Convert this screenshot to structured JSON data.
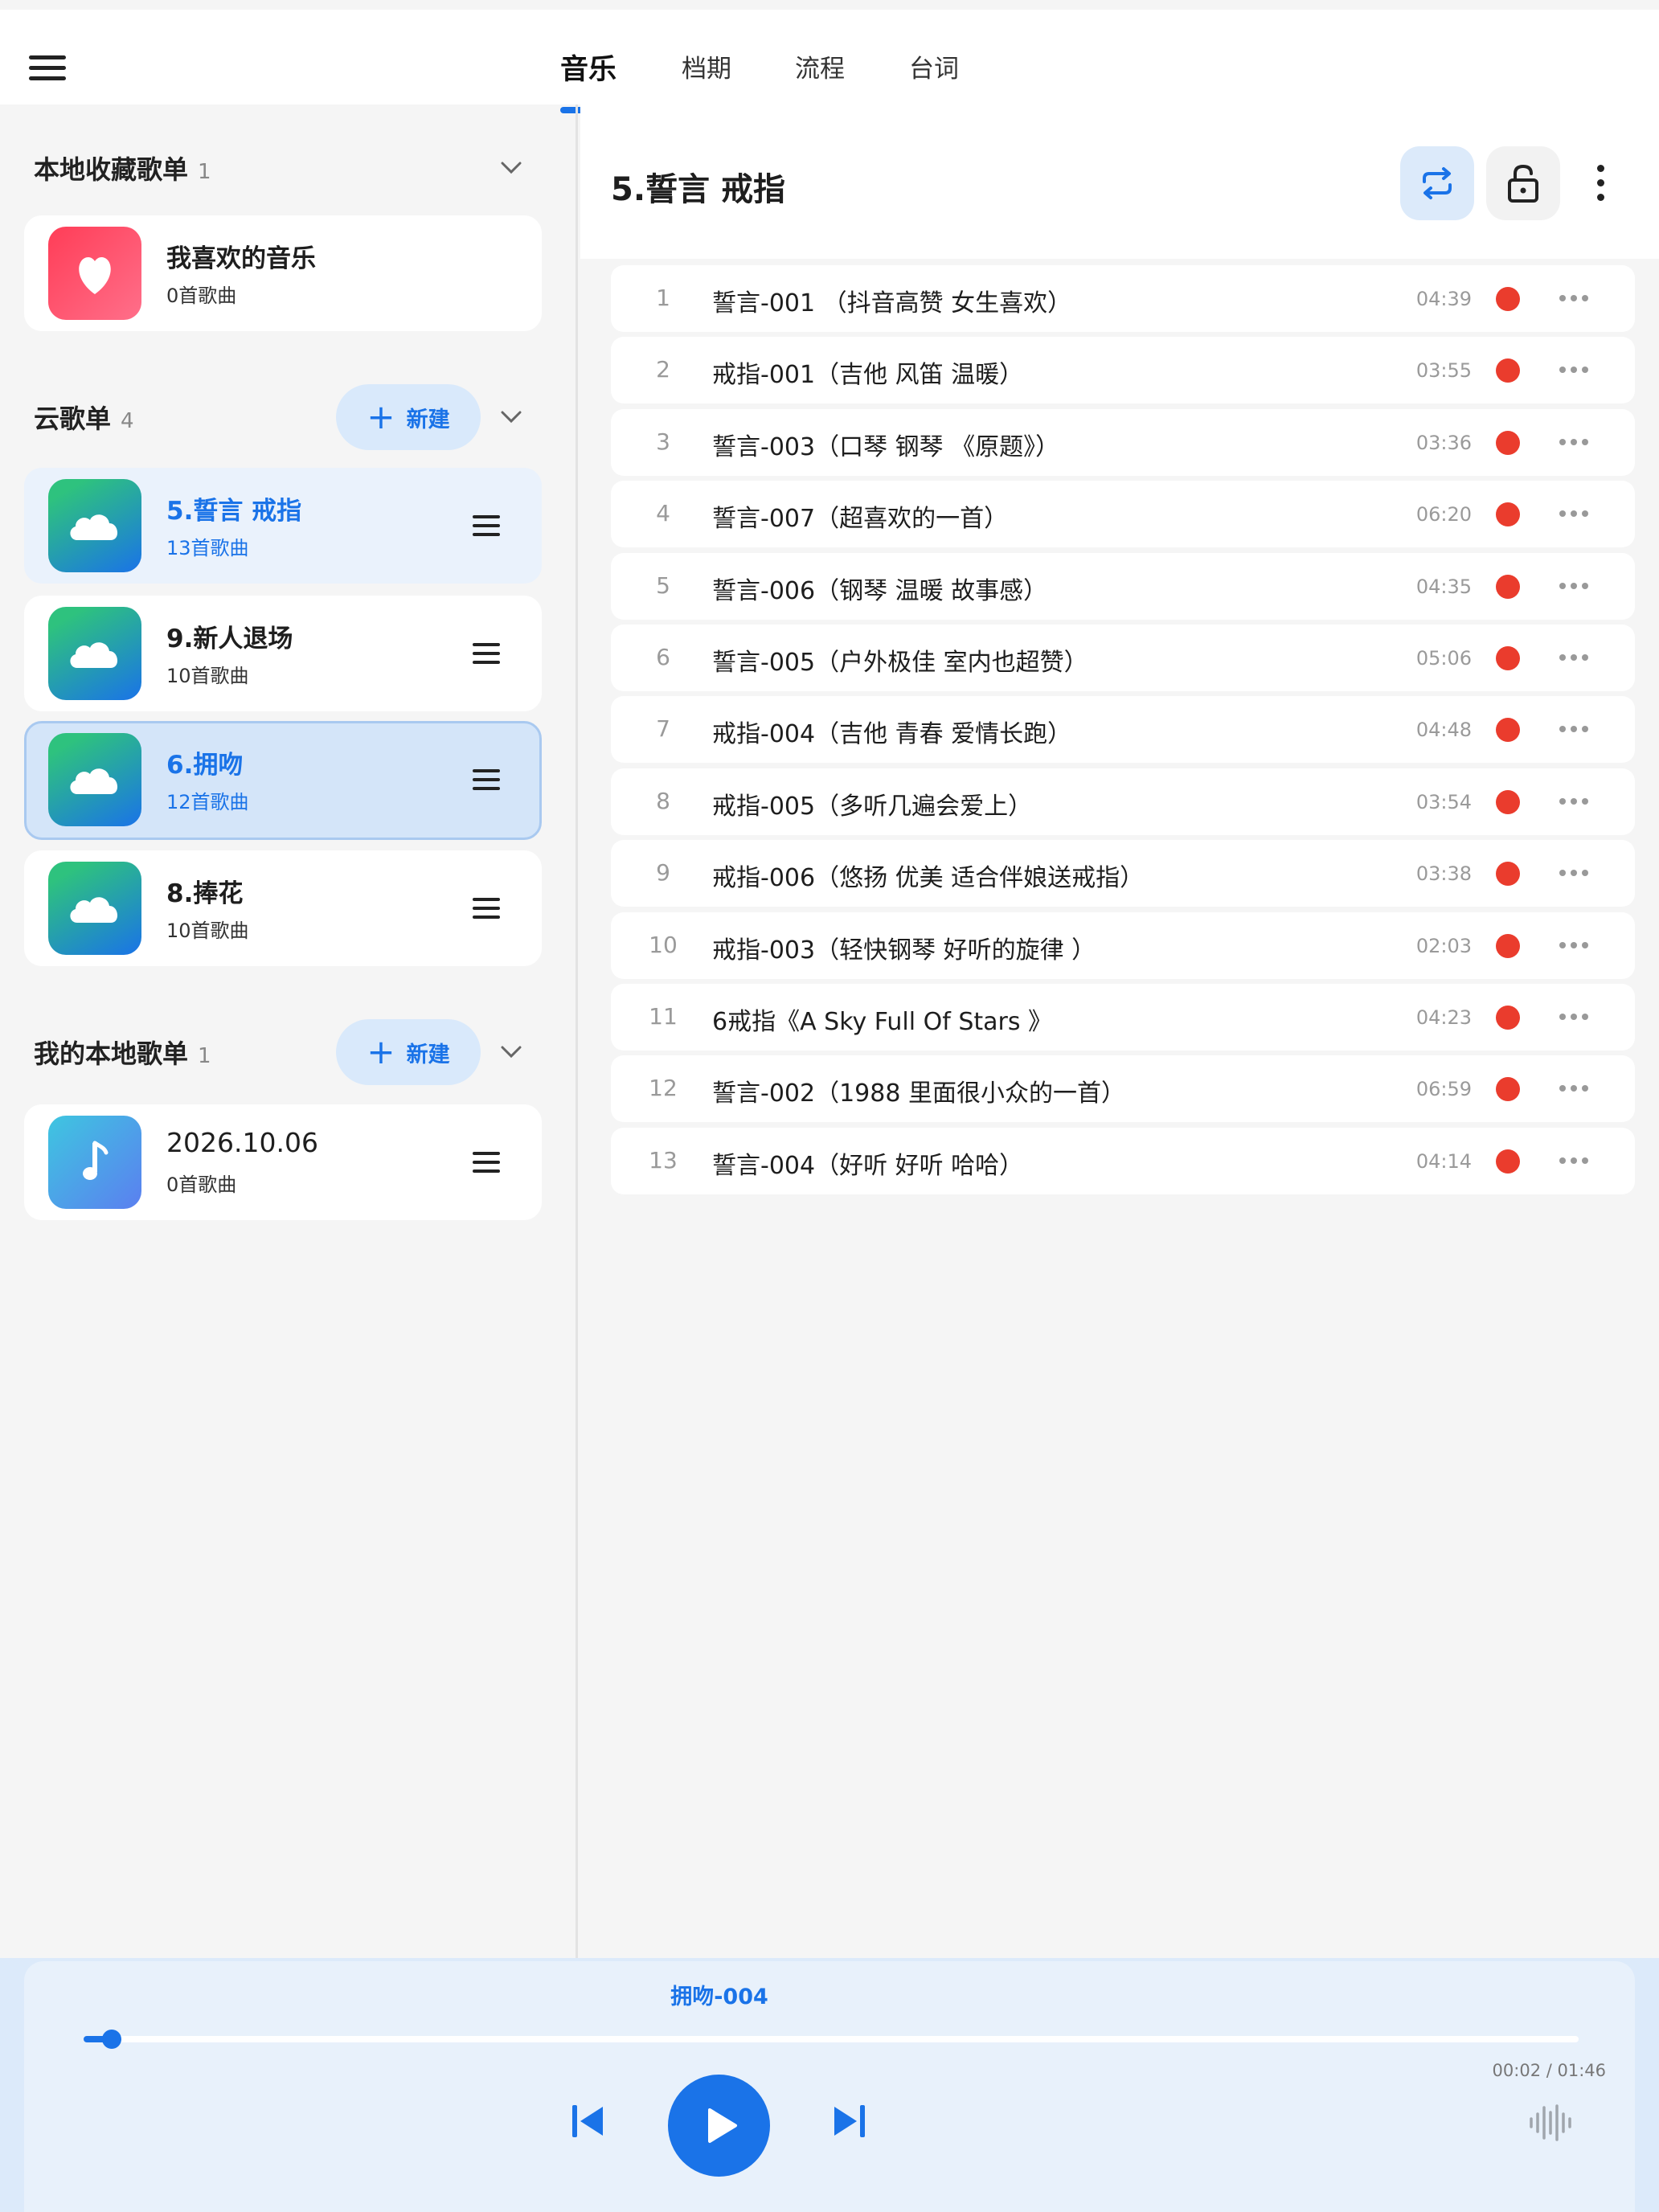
{
  "tabs": [
    {
      "label": "音乐",
      "active": true
    },
    {
      "label": "档期",
      "active": false
    },
    {
      "label": "流程",
      "active": false
    },
    {
      "label": "台词",
      "active": false
    }
  ],
  "sidebar": {
    "favorites": {
      "title": "本地收藏歌单",
      "count": "1",
      "items": [
        {
          "title": "我喜欢的音乐",
          "subtitle": "0首歌曲",
          "icon": "heart-icon"
        }
      ]
    },
    "cloud": {
      "title": "云歌单",
      "count": "4",
      "new_label": "新建",
      "items": [
        {
          "title": "5.誓言 戒指",
          "subtitle": "13首歌曲",
          "icon": "cloud-icon",
          "state": "selected"
        },
        {
          "title": "9.新人退场",
          "subtitle": "10首歌曲",
          "icon": "cloud-icon",
          "state": "normal"
        },
        {
          "title": "6.拥吻",
          "subtitle": "12首歌曲",
          "icon": "cloud-icon",
          "state": "playing"
        },
        {
          "title": "8.捧花",
          "subtitle": "10首歌曲",
          "icon": "cloud-icon",
          "state": "normal"
        }
      ]
    },
    "local": {
      "title": "我的本地歌单",
      "count": "1",
      "new_label": "新建",
      "items": [
        {
          "title": "2026.10.06",
          "subtitle": "0首歌曲",
          "icon": "music-note-icon"
        }
      ]
    }
  },
  "main": {
    "title": "5.誓言 戒指",
    "tracks": [
      {
        "num": "1",
        "name": "誓言-001 （抖音高赞 女生喜欢）",
        "duration": "04:39"
      },
      {
        "num": "2",
        "name": "戒指-001（吉他 风笛 温暖）",
        "duration": "03:55"
      },
      {
        "num": "3",
        "name": "誓言-003（口琴 钢琴 《原题》）",
        "duration": "03:36"
      },
      {
        "num": "4",
        "name": "誓言-007（超喜欢的一首）",
        "duration": "06:20"
      },
      {
        "num": "5",
        "name": "誓言-006（钢琴 温暖 故事感）",
        "duration": "04:35"
      },
      {
        "num": "6",
        "name": "誓言-005（户外极佳 室内也超赞）",
        "duration": "05:06"
      },
      {
        "num": "7",
        "name": "戒指-004（吉他 青春 爱情长跑）",
        "duration": "04:48"
      },
      {
        "num": "8",
        "name": "戒指-005（多听几遍会爱上）",
        "duration": "03:54"
      },
      {
        "num": "9",
        "name": "戒指-006（悠扬 优美 适合伴娘送戒指）",
        "duration": "03:38"
      },
      {
        "num": "10",
        "name": "戒指-003（轻快钢琴 好听的旋律 ）",
        "duration": "02:03"
      },
      {
        "num": "11",
        "name": "6戒指《A Sky Full Of Stars 》",
        "duration": "04:23"
      },
      {
        "num": "12",
        "name": "誓言-002（1988 里面很小众的一首）",
        "duration": "06:59"
      },
      {
        "num": "13",
        "name": "誓言-004（好听 好听 哈哈）",
        "duration": "04:14"
      }
    ]
  },
  "player": {
    "now_playing": "拥吻-004",
    "time": "00:02 / 01:46",
    "progress": 0.019
  },
  "colors": {
    "accent": "#1a73e8",
    "record_dot": "#ea3c2d",
    "heart_gradient": [
      "#ff3d57",
      "#ff6f8a"
    ],
    "cloud_gradient": [
      "#2ec27e",
      "#1a73e8"
    ],
    "note_gradient": [
      "#3ec6e0",
      "#5b7ff0"
    ]
  }
}
